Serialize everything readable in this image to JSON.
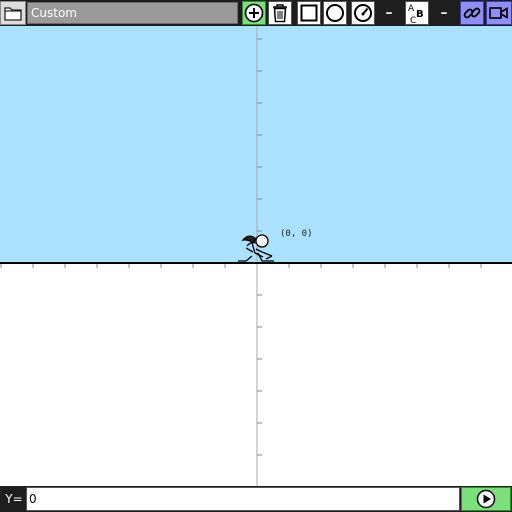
{
  "toolbar": {
    "title": "Custom",
    "icons": [
      "folder-icon",
      "add-icon",
      "trash-icon",
      "square-icon",
      "circle-icon",
      "gauge-icon",
      "minus-icon",
      "text-abc-icon",
      "minus-icon",
      "link-icon",
      "camera-icon"
    ],
    "minus_label": "–",
    "accent_green": "#7be07b",
    "accent_blue": "#8e8ef5"
  },
  "graph": {
    "sky_color": "#a9e1ff",
    "ground_color": "#ffffff",
    "origin_label": "(0, 0)"
  },
  "input_bar": {
    "label": "Y=",
    "value": "0"
  }
}
